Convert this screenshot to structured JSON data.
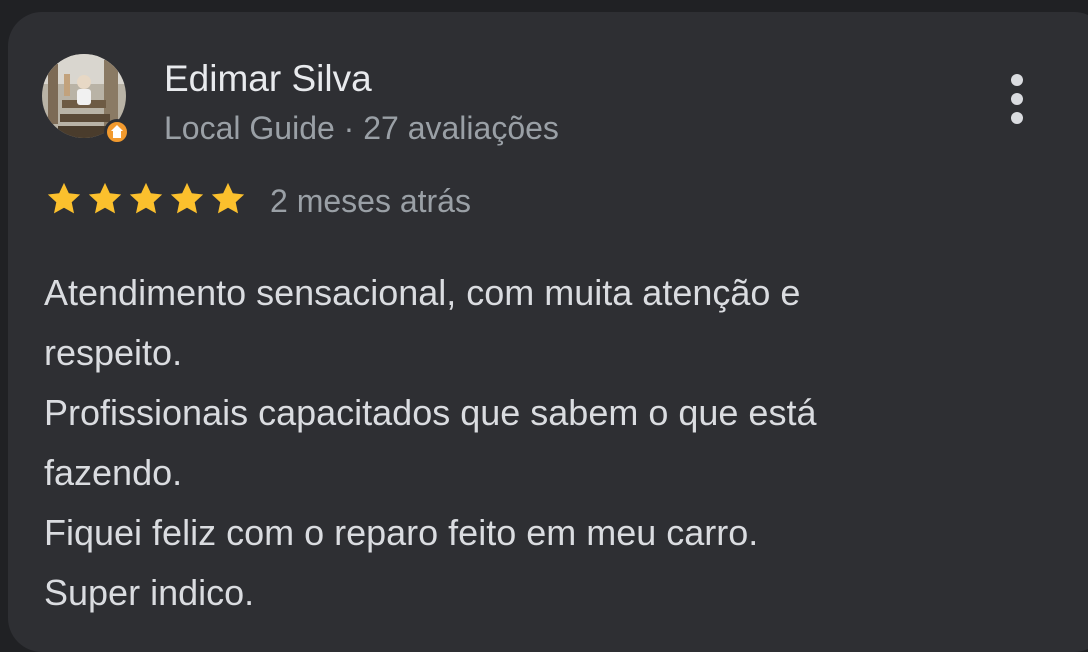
{
  "review": {
    "reviewer_name": "Edimar Silva",
    "reviewer_meta": "Local Guide · 27 avaliações",
    "rating": 5,
    "rating_max": 5,
    "date": "2 meses atrás",
    "body_lines": [
      "Atendimento sensacional, com muita atenção e",
      "respeito.",
      "Profissionais capacitados que sabem o que está",
      "fazendo.",
      "Fiquei feliz com o reparo feito em meu carro.",
      "Super indico."
    ]
  },
  "icons": {
    "avatar": "profile-photo",
    "badge": "local-guide-badge-icon",
    "menu": "more-vert-icon",
    "star": "star-icon"
  },
  "colors": {
    "background": "#202124",
    "card": "#2e2f33",
    "star": "#fbc02d",
    "primary_text": "#e8eaed",
    "secondary_text": "#9aa0a6",
    "badge": "#f29a2e"
  }
}
